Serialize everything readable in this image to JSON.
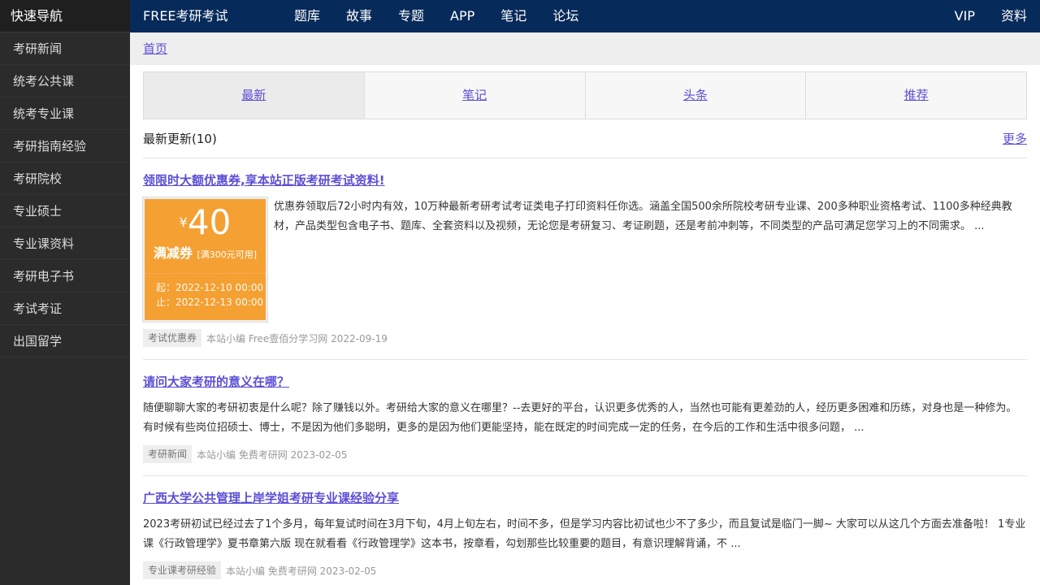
{
  "sidebar": {
    "title": "快速导航",
    "items": [
      "考研新闻",
      "统考公共课",
      "统考专业课",
      "考研指南经验",
      "考研院校",
      "专业硕士",
      "专业课资料",
      "考研电子书",
      "考试考证",
      "出国留学"
    ]
  },
  "topnav": {
    "brand": "FREE考研考试",
    "links": [
      "题库",
      "故事",
      "专题",
      "APP",
      "笔记",
      "论坛"
    ],
    "right": [
      "VIP",
      "资料"
    ]
  },
  "breadcrumb": {
    "home": "首页"
  },
  "tabs": [
    "最新",
    "笔记",
    "头条",
    "推荐"
  ],
  "list": {
    "title": "最新更新(10)",
    "more": "更多"
  },
  "articles": [
    {
      "title": "领限时大额优惠券,享本站正版考研考试资料!",
      "text": "优惠券领取后72小时内有效，10万种最新考研考试考证类电子打印资料任你选。涵盖全国500余所院校考研专业课、200多种职业资格考试、1100多种经典教材，产品类型包含电子书、题库、全套资料以及视频，无论您是考研复习、考证刷题，还是考前冲刺等，不同类型的产品可满足您学习上的不同需求。 ...",
      "tag": "考试优惠券",
      "meta": "本站小编 Free壹佰分学习网 2022-09-19",
      "coupon": {
        "yen": "¥",
        "amount": "40",
        "name": "满减券",
        "condition": "[满300元可用]",
        "start": "起：2022-12-10 00:00",
        "end": "止：2022-12-13 00:00"
      }
    },
    {
      "title": "请问大家考研的意义在哪？",
      "text": "随便聊聊大家的考研初衷是什么呢？除了赚钱以外。考研给大家的意义在哪里？--去更好的平台，认识更多优秀的人，当然也可能有更差劲的人，经历更多困难和历练，对身也是一种修为。有时候有些岗位招硕士、博士，不是因为他们多聪明，更多的是因为他们更能坚持，能在既定的时间完成一定的任务，在今后的工作和生活中很多问题， ...",
      "tag": "考研新闻",
      "meta": "本站小编 免费考研网 2023-02-05"
    },
    {
      "title": "广西大学公共管理上岸学姐考研专业课经验分享",
      "text": "2023考研初试已经过去了1个多月，每年复试时间在3月下旬，4月上旬左右，时间不多，但是学习内容比初试也少不了多少，而且复试是临门一脚~ 大家可以从这几个方面去准备啦！ 1专业课《行政管理学》夏书章第六版 现在就看看《行政管理学》这本书，按章看，勾划那些比较重要的题目，有意识理解背诵，不 ...",
      "tag": "专业课考研经验",
      "meta": "本站小编 免费考研网 2023-02-05"
    }
  ]
}
